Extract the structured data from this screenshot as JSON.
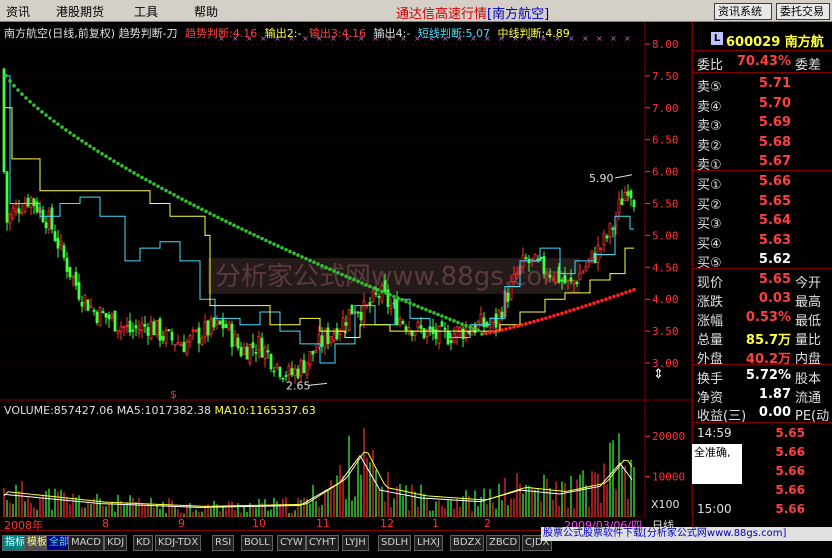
{
  "menu": {
    "items": [
      "资讯",
      "港股期货",
      "工具",
      "帮助"
    ],
    "app_title": "通达信高速行情",
    "app_subtitle": "[南方航空]",
    "btn_news": "资讯系统",
    "btn_trade": "委托交易"
  },
  "legend": {
    "name": "南方航空(日线,前复权) 趋势判断-刀",
    "trend": "趋势判断:4.16",
    "out2": "输出2:-",
    "out3": "输出3:4.16",
    "out4": "输出4:-",
    "short": "短线判断:5.07",
    "mid": "中线判断:4.89"
  },
  "annotations": {
    "high": "5.90",
    "low": "2.65",
    "dollar": "$"
  },
  "price_axis": [
    "8.00",
    "7.50",
    "7.00",
    "6.50",
    "6.00",
    "5.50",
    "5.00",
    "4.50",
    "4.00",
    "3.50",
    "3.00"
  ],
  "volume": {
    "legend_vol": "VOLUME:857427.06",
    "legend_ma5": "MA5:1017382.38",
    "legend_ma10": "MA10:1165337.63",
    "axis": [
      "20000",
      "10000"
    ],
    "unit": "X100"
  },
  "dates": [
    "2008年",
    "8",
    "9",
    "10",
    "11",
    "12",
    "1",
    "2",
    "2009/03/06/四"
  ],
  "date_right": "日线",
  "panel": {
    "badge": "L",
    "code": "600029 南方航",
    "ratio_label": "委比",
    "ratio_val": "70.43%",
    "ratio_extra": "委差",
    "asks": [
      {
        "label": "卖⑤",
        "price": "5.71"
      },
      {
        "label": "卖④",
        "price": "5.70"
      },
      {
        "label": "卖③",
        "price": "5.69"
      },
      {
        "label": "卖②",
        "price": "5.68"
      },
      {
        "label": "卖①",
        "price": "5.67"
      }
    ],
    "bids": [
      {
        "label": "买①",
        "price": "5.66"
      },
      {
        "label": "买②",
        "price": "5.65"
      },
      {
        "label": "买③",
        "price": "5.64"
      },
      {
        "label": "买④",
        "price": "5.63"
      },
      {
        "label": "买⑤",
        "price": "5.62"
      }
    ],
    "stats": [
      {
        "label": "现价",
        "value": "5.65",
        "extra": "今开"
      },
      {
        "label": "涨跌",
        "value": "0.03",
        "extra": "最高"
      },
      {
        "label": "涨幅",
        "value": "0.53%",
        "extra": "最低"
      },
      {
        "label": "总量",
        "value": "85.7万",
        "extra": "量比"
      },
      {
        "label": "外盘",
        "value": "40.2万",
        "extra": "内盘"
      }
    ],
    "stats2": [
      {
        "label": "换手",
        "value": "5.72%",
        "extra": "股本"
      },
      {
        "label": "净资",
        "value": "1.87",
        "extra": "流通"
      },
      {
        "label": "收益(三)",
        "value": "0.00",
        "extra": "PE(动"
      }
    ],
    "ticks": [
      {
        "time": "14:59",
        "price": "5.65"
      },
      {
        "time": "",
        "price": "5.66"
      },
      {
        "time": "",
        "price": "5.66"
      },
      {
        "time": "",
        "price": "5.66"
      },
      {
        "time": "15:00",
        "price": "5.66"
      }
    ],
    "info_text": "全准确,"
  },
  "bottom_tabs": [
    "指标",
    "模板",
    "全部",
    "MACD",
    "KDJ",
    "KD",
    "KDJ-TDX",
    "RSI",
    "BOLL",
    "CYW",
    "CYHT",
    "LYJH",
    "SDLH",
    "LHXJ",
    "BDZX",
    "ZBCD",
    "CJDX"
  ],
  "ad_text": "股票公式股票软件下载[分析家公式网www.88gs.com]",
  "watermark": "分析家公式网www.88gs.com",
  "colors": {
    "up": "#ff3030",
    "down": "#40ff40",
    "ma_green": "#30c030",
    "ma_red": "#ff2020",
    "short_line": "#40e0ff",
    "mid_line": "#ffff40"
  }
}
